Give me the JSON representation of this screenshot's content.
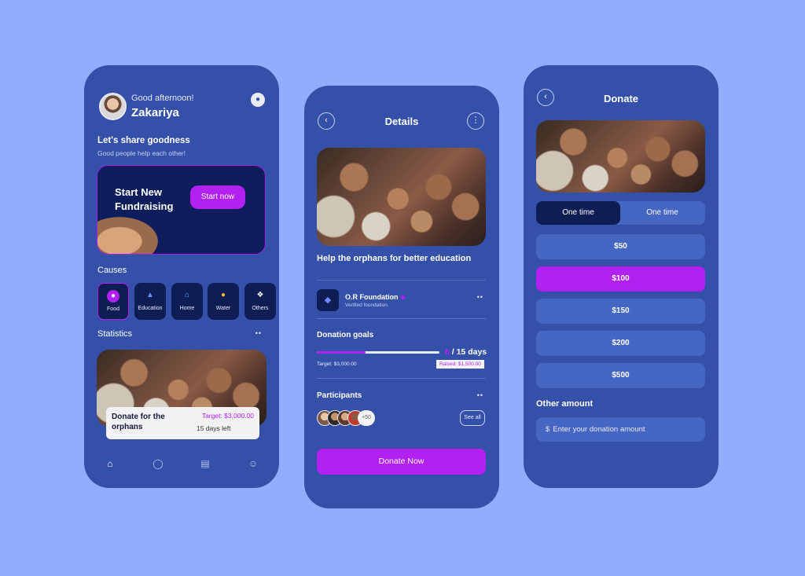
{
  "home": {
    "greeting": "Good afternoon!",
    "user_name": "Zakariya",
    "share_title": "Let's share goodness",
    "share_subtitle": "Good people help each other!",
    "fundraising_title": "Start New Fundraising",
    "start_button": "Start now",
    "causes_heading": "Causes",
    "causes": [
      {
        "label": "Food",
        "icon": "food-icon"
      },
      {
        "label": "Education",
        "icon": "education-icon"
      },
      {
        "label": "Home",
        "icon": "home-icon"
      },
      {
        "label": "Water",
        "icon": "water-icon"
      },
      {
        "label": "Others",
        "icon": "others-icon"
      }
    ],
    "statistics_heading": "Statistics",
    "stat_card": {
      "title": "Donate for the orphans",
      "target": "Target: $3,000.00",
      "days_left": "15 days left"
    },
    "nav": [
      "home-icon",
      "activity-icon",
      "calendar-icon",
      "profile-icon"
    ]
  },
  "details": {
    "title": "Details",
    "heading": "Help the orphans for better education",
    "org_name": "O.R Foundation",
    "org_sub": "Verified foundation",
    "goals_heading": "Donation goals",
    "goal_progress": 0.4,
    "days_current": "6",
    "days_total": " / 15 days",
    "target": "Target: $3,000.00",
    "raised": "Raised: $1,500.00",
    "participants_heading": "Participants",
    "participants_more": "+50",
    "see_all": "See all",
    "donate_button": "Donate  Now"
  },
  "donate": {
    "title": "Donate",
    "toggle_options": [
      "One time",
      "One time"
    ],
    "amounts": [
      "$50",
      "$100",
      "$150",
      "$200",
      "$500"
    ],
    "selected_amount": "$100",
    "other_heading": "Other amount",
    "currency_symbol": "$",
    "input_placeholder": "Enter your donation amount"
  },
  "colors": {
    "background": "#93acfd",
    "phone": "#3450a8",
    "dark": "#0f1d55",
    "accent": "#b321f0"
  }
}
